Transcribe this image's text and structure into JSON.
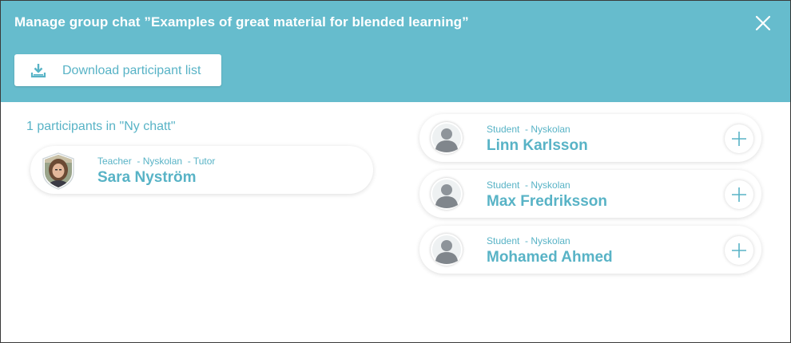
{
  "dialog": {
    "title": "Manage group chat ”Examples of great material for blended learning”",
    "close_icon": "close-icon",
    "download_label": "Download participant list",
    "download_icon": "download-icon"
  },
  "participants": {
    "count_label": "1 participants in \"Ny chatt\"",
    "items": [
      {
        "role": "Teacher",
        "school": "- Nyskolan",
        "extra": "- Tutor",
        "name": "Sara Nyström",
        "avatar": "user-photo"
      }
    ]
  },
  "candidates": {
    "items": [
      {
        "role": "Student",
        "school": "- Nyskolan",
        "name": "Linn Karlsson",
        "avatar": "default-user-icon",
        "action": "add-icon"
      },
      {
        "role": "Student",
        "school": "- Nyskolan",
        "name": "Max Fredriksson",
        "avatar": "default-user-icon",
        "action": "add-icon"
      },
      {
        "role": "Student",
        "school": "- Nyskolan",
        "name": "Mohamed Ahmed",
        "avatar": "default-user-icon",
        "action": "add-icon"
      }
    ]
  },
  "colors": {
    "header_bg": "#66bccd",
    "accent_text": "#58b3c6",
    "white": "#ffffff"
  }
}
